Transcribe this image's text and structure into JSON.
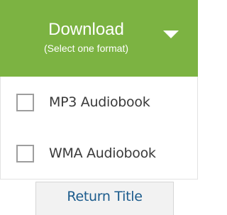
{
  "download": {
    "label": "Download",
    "sublabel": "(Select one format)",
    "icon": "caret-down-icon",
    "color": "#7cb342"
  },
  "formats": [
    {
      "label": "MP3 Audiobook",
      "checked": false
    },
    {
      "label": "WMA Audiobook",
      "checked": false
    }
  ],
  "return_button": {
    "label": "Return Title"
  }
}
